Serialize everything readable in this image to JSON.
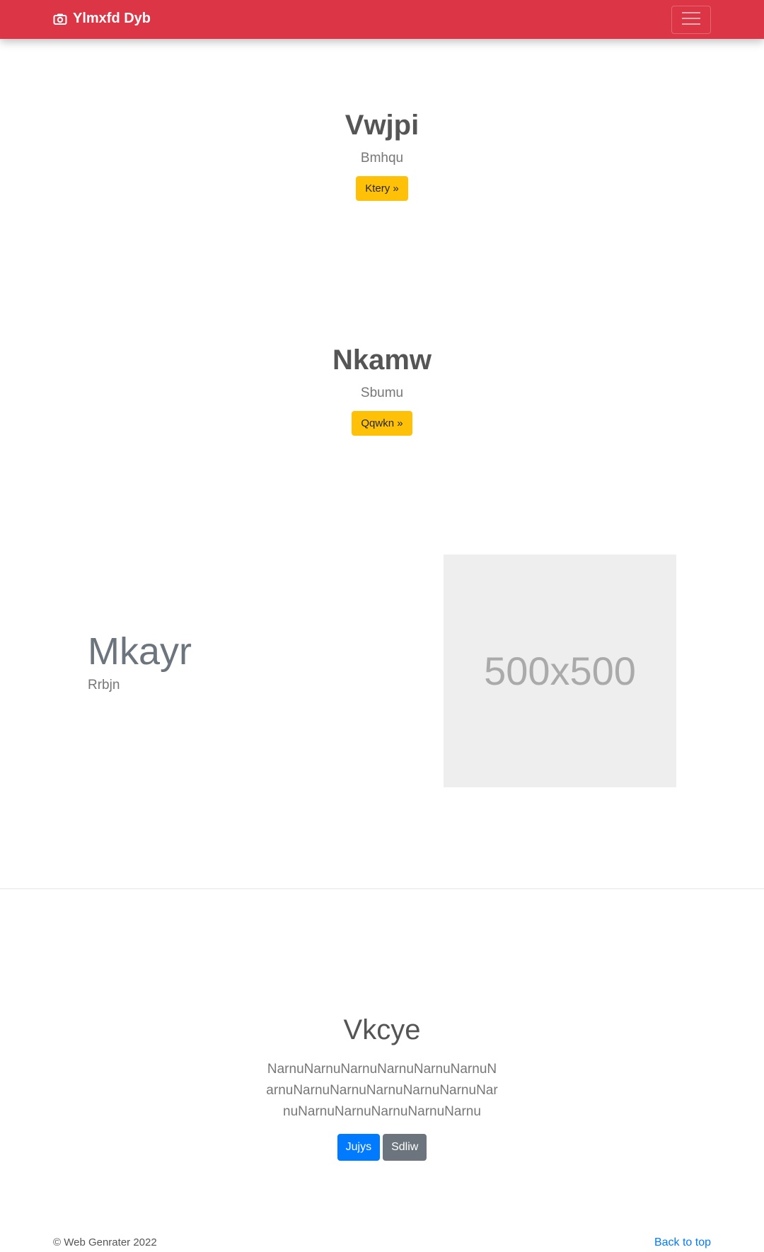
{
  "navbar": {
    "brand": "Ylmxfd Dyb",
    "brand_icon": "camera-icon",
    "toggler_icon": "hamburger-icon",
    "color": "#dc3545"
  },
  "hero1": {
    "title": "Vwjpi",
    "subtitle": "Bmhqu",
    "button": "Ktery »"
  },
  "hero2": {
    "title": "Nkamw",
    "subtitle": "Sbumu",
    "button": "Qqwkn »"
  },
  "feature": {
    "title": "Mkayr",
    "subtitle": "Rrbjn",
    "image_label": "500x500"
  },
  "cta": {
    "title": "Vkcye",
    "lead": "NarnuNarnuNarnuNarnuNarnuNarnuNarnuNarnuNarnuNarnuNarnuNarnuNarnuNarnuNarnuNarnuNarnuNarnu",
    "primary_button": "Jujys",
    "secondary_button": "Sdliw"
  },
  "footer": {
    "copyright": "© Web Genrater 2022",
    "back_to_top": "Back to top"
  }
}
